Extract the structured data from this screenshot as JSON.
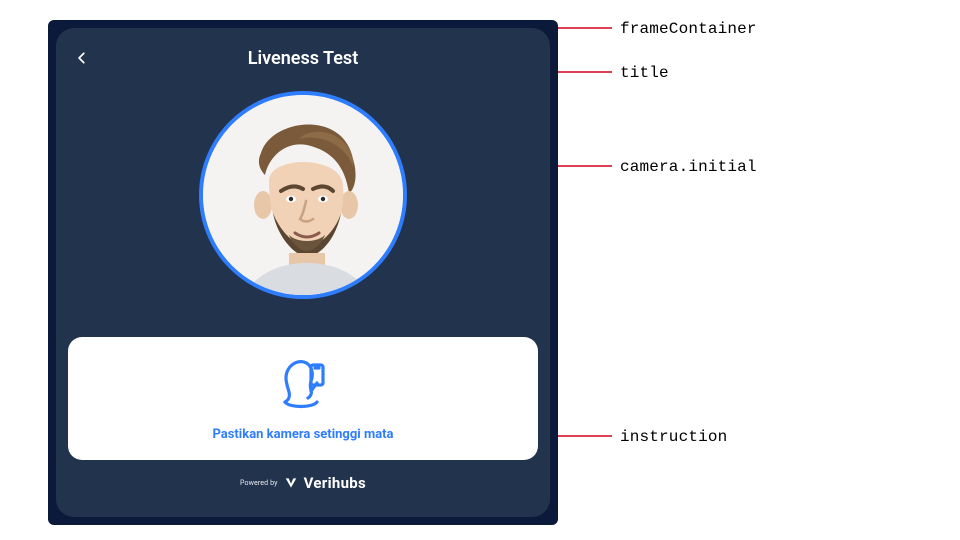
{
  "annotations": {
    "frameContainer": "frameContainer",
    "title": "title",
    "cameraInitial": "camera.initial",
    "instruction": "instruction"
  },
  "frame": {
    "title": "Liveness Test",
    "instruction_text": "Pastikan kamera setinggi mata",
    "powered_by": "Powered by",
    "brand": "Verihubs"
  },
  "colors": {
    "accent": "#2f7dff",
    "panel": "#22334d",
    "panel_outer": "#0b1a3a",
    "annotation": "#d0021b"
  }
}
